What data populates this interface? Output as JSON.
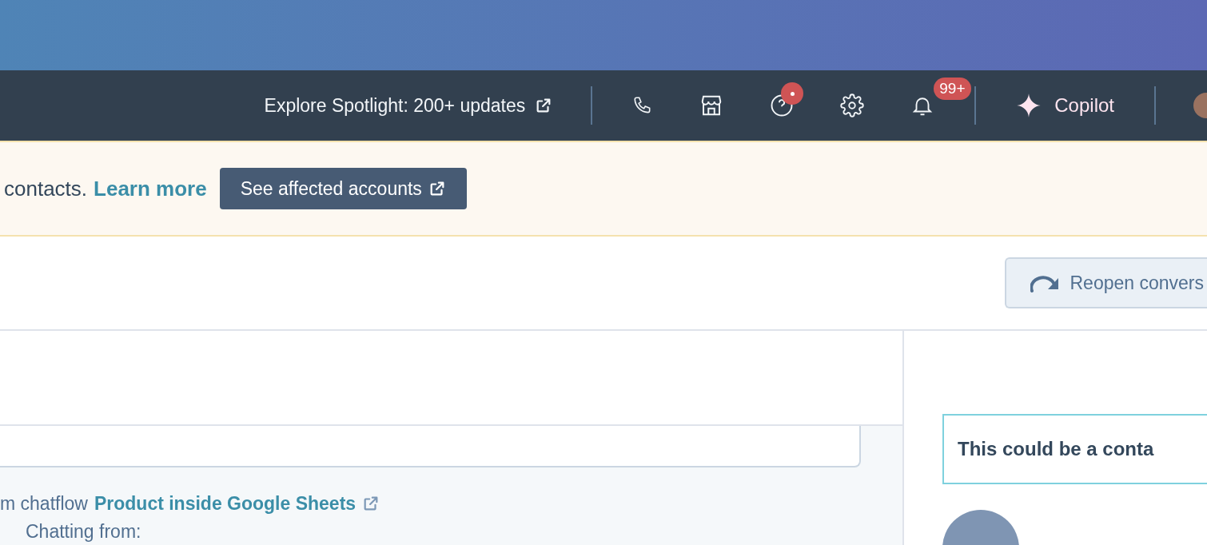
{
  "top_nav": {
    "spotlight_link": "Explore Spotlight: 200+ updates",
    "help_alert": true,
    "notifications_badge": "99+",
    "copilot_label": "Copilot"
  },
  "banner": {
    "text": "contacts.",
    "link": "Learn more",
    "button": "See affected accounts"
  },
  "toolbar": {
    "reopen_button": "Reopen convers"
  },
  "conversation": {
    "chatflow_prefix": "m chatflow",
    "chatflow_link": "Product inside Google Sheets",
    "chatting_from": "Chatting from:"
  },
  "sidebar": {
    "contact_prompt": "This could be a conta"
  }
}
